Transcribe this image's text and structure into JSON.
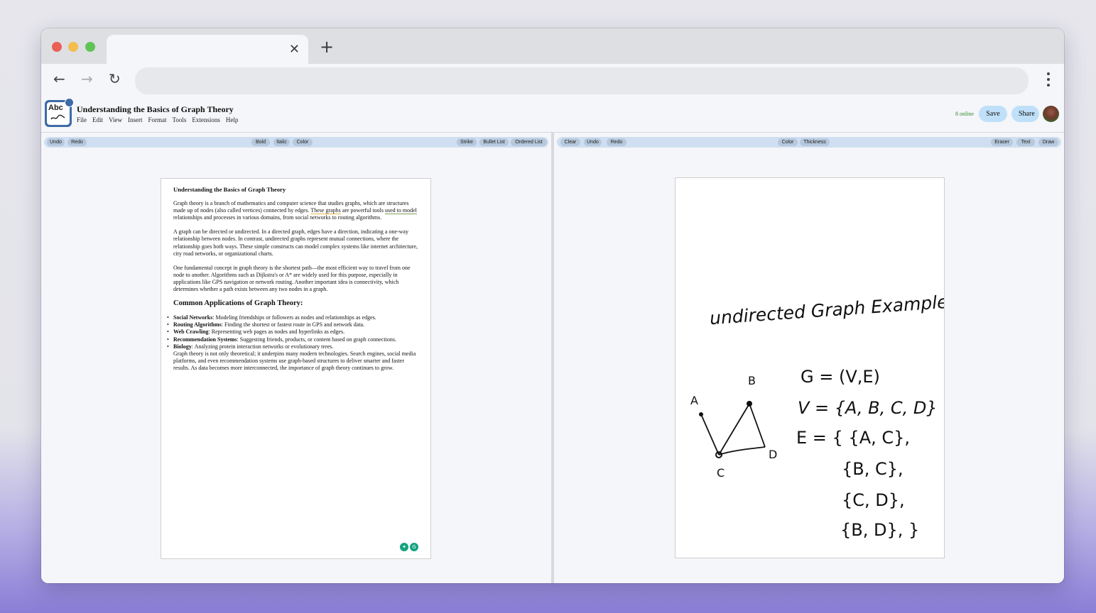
{
  "browser": {
    "tab_title": "",
    "tab_close": "✕",
    "new_tab": "+",
    "back": "←",
    "forward": "→",
    "reload": "↻",
    "url": ""
  },
  "app": {
    "title": "Understanding the Basics of Graph Theory",
    "logo_text": "Abc",
    "menu": [
      "File",
      "Edit",
      "View",
      "Insert",
      "Format",
      "Tools",
      "Extensions",
      "Help"
    ],
    "online_status": "8 online",
    "save_label": "Save",
    "share_label": "Share"
  },
  "editor_toolbar": {
    "undo": "Undo",
    "redo": "Redo",
    "bold": "Bold",
    "italic": "Italic",
    "color": "Color",
    "strike": "Strike",
    "bullet_list": "Bullet List",
    "ordered_list": "Ordered List"
  },
  "canvas_toolbar": {
    "clear": "Clear",
    "undo": "Undo",
    "redo": "Redo",
    "color": "Color",
    "thickness": "Thickness",
    "eraser": "Eraser",
    "text": "Text",
    "draw": "Draw"
  },
  "document": {
    "title": "Understanding the Basics of Graph Theory",
    "p1_a": "Graph theory is a branch of mathematics and computer science that studies graphs, which are structures made up of nodes (also called vertices) connected by edges. ",
    "p1_u1": "These graphs",
    "p1_b": " are powerful tools ",
    "p1_u2": "used to model",
    "p1_c": " relationships and processes in various domains, from social networks to routing algorithms.",
    "p2": "A graph can be directed or undirected. In a directed graph, edges have a direction, indicating a one-way relationship between nodes. In contrast, undirected graphs represent mutual connections, where the relationship goes both ways. These simple constructs can model complex systems like internet architecture, city road networks, or organizational charts.",
    "p3": "One fundamental concept in graph theory is the shortest path—the most efficient way to travel from one node to another. Algorithms such as Dijkstra's or A* are widely used for this purpose, especially in applications like GPS navigation or network routing. Another important idea is connectivity, which determines whether a path exists between any two nodes in a graph.",
    "h2": "Common Applications of Graph Theory:",
    "bullets": [
      {
        "term": "Social Networks",
        "text": ": Modeling friendships or followers as nodes and relationships as edges."
      },
      {
        "term": "Routing Algorithms",
        "text": ": Finding the shortest or fastest route in GPS and network data."
      },
      {
        "term": "Web Crawling",
        "text": ": Representing web pages as nodes and hyperlinks as edges."
      },
      {
        "term": "Recommendation Systems",
        "text": ": Suggesting friends, products, or content based on graph connections."
      },
      {
        "term": "Biology",
        "text": ": Analyzing protein interaction networks or evolutionary trees."
      }
    ],
    "closing": "Graph theory is not only theoretical; it underpins many modern technologies. Search engines, social media platforms, and even recommendation systems use graph-based structures to deliver smarter and faster results. As data becomes more interconnected, the importance of graph theory continues to grow."
  },
  "drawing": {
    "heading": "undirected Graph Example :",
    "node_labels": [
      "A",
      "B",
      "C",
      "D"
    ],
    "lines": [
      "G = (V,E)",
      "V = {A, B, C, D}",
      "E = { {A, C},",
      "{B, C},",
      "{C, D},",
      "{B, D}, }"
    ]
  },
  "colors": {
    "accent": "#3d6ba7",
    "pill": "#bfe0f8",
    "online": "#2e8b2e"
  }
}
